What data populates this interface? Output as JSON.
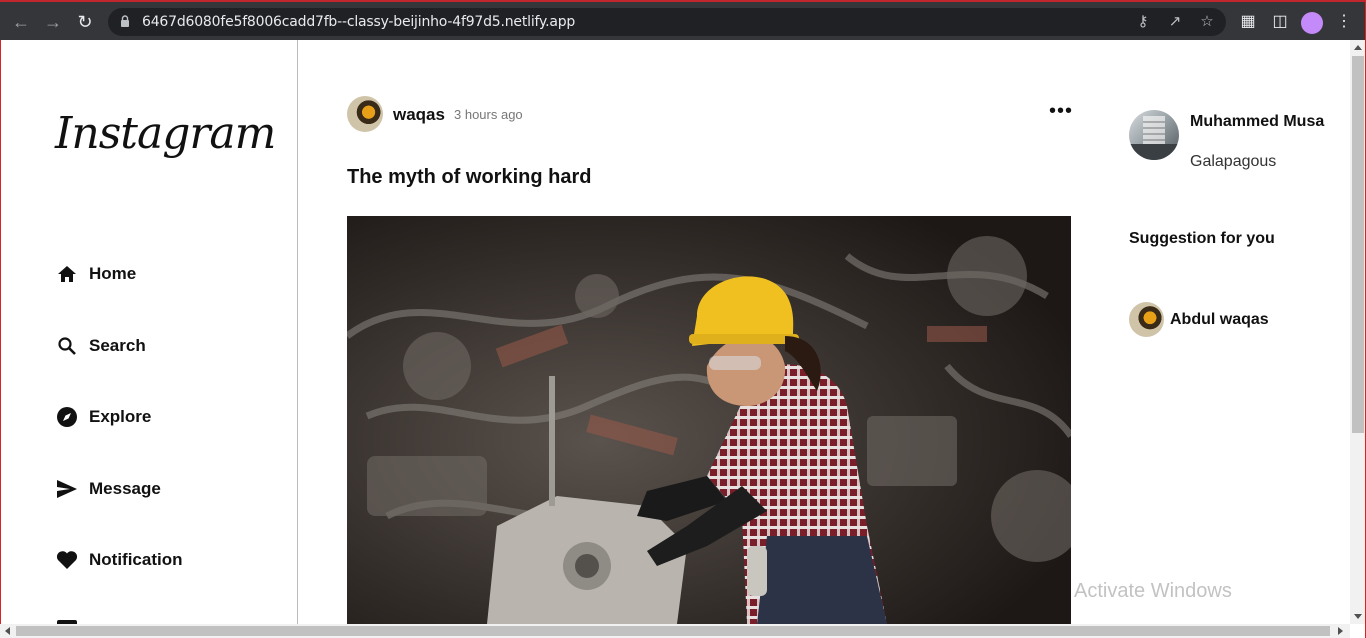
{
  "browser": {
    "url": "6467d6080fe5f8006cadd7fb--classy-beijinho-4f97d5.netlify.app",
    "icons": [
      "back-icon",
      "forward-icon",
      "reload-icon",
      "lock-icon",
      "key-icon",
      "share-icon",
      "star-icon",
      "extensions-icon",
      "side-panel-icon",
      "profile-icon",
      "menu-icon"
    ]
  },
  "sidebar": {
    "logo": "Instagram",
    "items": [
      {
        "label": "Home",
        "icon": "home-icon"
      },
      {
        "label": "Search",
        "icon": "search-icon"
      },
      {
        "label": "Explore",
        "icon": "compass-icon"
      },
      {
        "label": "Message",
        "icon": "send-icon"
      },
      {
        "label": "Notification",
        "icon": "heart-icon"
      }
    ]
  },
  "post": {
    "username": "waqas",
    "time": "3 hours ago",
    "title": "The myth of working hard",
    "more_icon": "more-icon"
  },
  "right": {
    "profile": {
      "name": "Muhammed Musa",
      "location": "Galapagous"
    },
    "suggestion_title": "Suggestion for you",
    "suggestions": [
      {
        "name": "Abdul waqas"
      }
    ]
  },
  "watermark": "Activate Windows"
}
